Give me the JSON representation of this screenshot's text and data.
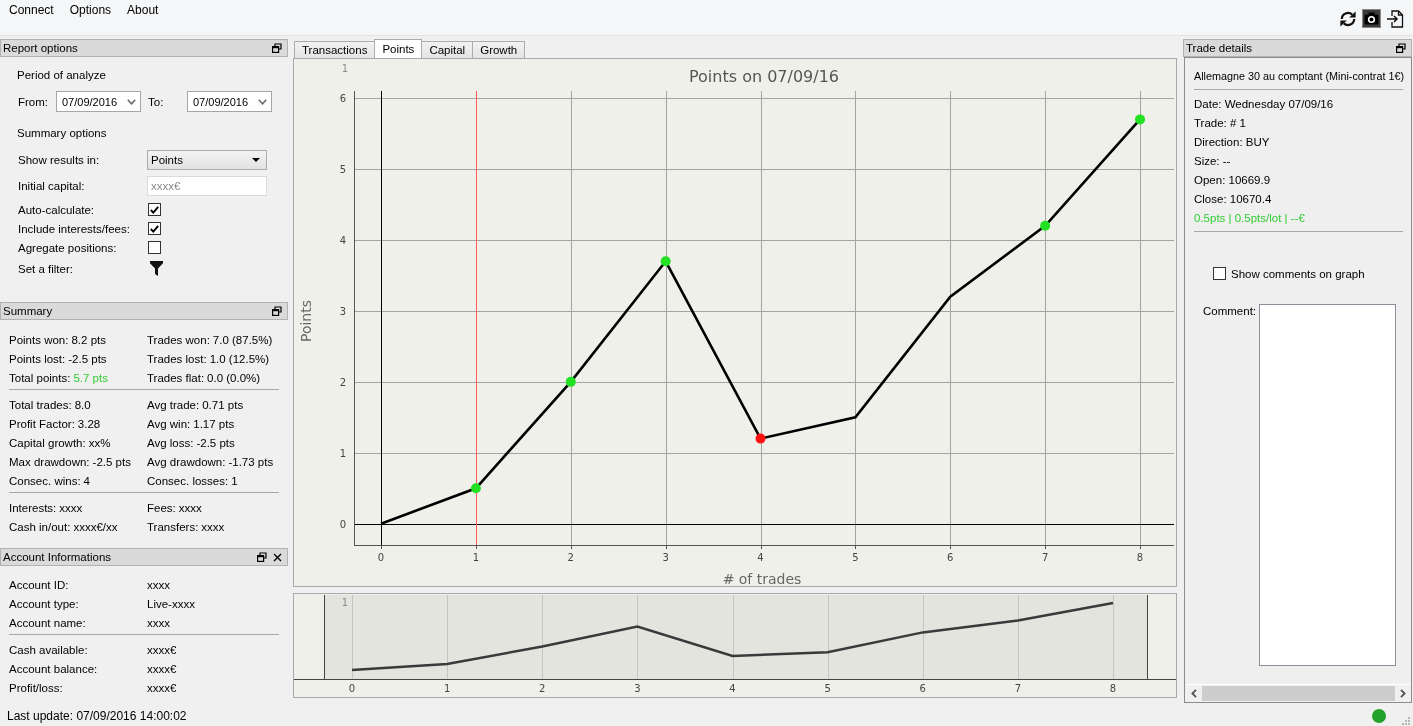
{
  "menu": [
    "Connect",
    "Options",
    "About"
  ],
  "report_options": {
    "title": "Report options",
    "closable": false,
    "period_heading": "Period of analyze",
    "from": {
      "label": "From:",
      "value": "07/09/2016"
    },
    "to": {
      "label": "To:",
      "value": "07/09/2016"
    },
    "summary_heading": "Summary options",
    "fields": [
      {
        "kind": "select",
        "label": "Show results in:",
        "value": "Points"
      },
      {
        "kind": "input",
        "label": "Initial capital:",
        "placeholder": "xxxx€"
      },
      {
        "kind": "checkbox",
        "label": "Auto-calculate:",
        "checked": true
      },
      {
        "kind": "checkbox",
        "label": "Include interests/fees:",
        "checked": true
      },
      {
        "kind": "checkbox",
        "label": "Agregate positions:",
        "checked": false
      },
      {
        "kind": "filter",
        "label": "Set a filter:"
      }
    ]
  },
  "summary": {
    "title": "Summary",
    "closable": false,
    "groups": [
      {
        "items": [
          {
            "label": "Points won:",
            "value": "8.2 pts",
            "highlighted": false
          },
          {
            "label": "Trades won:",
            "value": "7.0 (87.5%)",
            "highlighted": false
          },
          {
            "label": "Points lost:",
            "value": "-2.5 pts",
            "highlighted": false
          },
          {
            "label": "Trades lost:",
            "value": "1.0 (12.5%)",
            "highlighted": false
          },
          {
            "label": "Total points:",
            "value": "5.7 pts",
            "highlighted": true
          },
          {
            "label": "Trades flat:",
            "value": "0.0 (0.0%)",
            "highlighted": false
          }
        ]
      },
      {
        "items": [
          {
            "label": "Total trades:",
            "value": "8.0",
            "highlighted": false
          },
          {
            "label": "Avg trade:",
            "value": "0.71 pts",
            "highlighted": false
          },
          {
            "label": "Profit Factor:",
            "value": "3.28",
            "highlighted": false
          },
          {
            "label": "Avg win:",
            "value": "1.17 pts",
            "highlighted": false
          },
          {
            "label": "Capital growth:",
            "value": "xx%",
            "highlighted": false
          },
          {
            "label": "Avg loss:",
            "value": "-2.5 pts",
            "highlighted": false
          },
          {
            "label": "Max drawdown:",
            "value": "-2.5 pts",
            "highlighted": false
          },
          {
            "label": "Avg drawdown:",
            "value": "-1.73 pts",
            "highlighted": false
          },
          {
            "label": "Consec. wins:",
            "value": "4",
            "highlighted": false
          },
          {
            "label": "Consec. losses:",
            "value": "1",
            "highlighted": false
          }
        ]
      },
      {
        "items": [
          {
            "label": "Interests:",
            "value": "xxxx",
            "highlighted": false
          },
          {
            "label": "Fees:",
            "value": "xxxx",
            "highlighted": false
          },
          {
            "label": "Cash in/out:",
            "value": "xxxx€/xx",
            "highlighted": false
          },
          {
            "label": "Transfers:",
            "value": "xxxx",
            "highlighted": false
          }
        ]
      }
    ]
  },
  "account": {
    "title": "Account Informations",
    "closable": true,
    "groups": [
      {
        "items": [
          {
            "label": "Account ID:",
            "value": "xxxx"
          },
          {
            "label": "Account type:",
            "value": "Live-xxxx"
          },
          {
            "label": "Account name:",
            "value": "xxxx"
          }
        ]
      },
      {
        "items": [
          {
            "label": "Cash available:",
            "value": "xxxx€"
          },
          {
            "label": "Account balance:",
            "value": "xxxx€"
          },
          {
            "label": "Profit/loss:",
            "value": "xxxx€"
          }
        ]
      }
    ]
  },
  "tabs": [
    {
      "label": "Transactions",
      "selected": false
    },
    {
      "label": "Points",
      "selected": true
    },
    {
      "label": "Capital",
      "selected": false
    },
    {
      "label": "Growth",
      "selected": false
    }
  ],
  "main_chart": {
    "corner_label": "1",
    "chart_data": {
      "type": "line",
      "title": "Points on 07/09/16",
      "xlabel": "# of trades",
      "ylabel": "Points",
      "x": [
        0,
        1,
        2,
        3,
        4,
        5,
        6,
        7,
        8
      ],
      "series": [
        {
          "color": "#000000",
          "values": [
            0,
            0.5,
            2.0,
            3.7,
            1.2,
            1.5,
            3.2,
            4.2,
            5.7
          ]
        },
        {
          "type": "scatter",
          "color": "#22e022",
          "values": [
            null,
            0.5,
            2.0,
            3.7,
            null,
            null,
            null,
            4.2,
            5.7
          ]
        },
        {
          "type": "scatter",
          "color": "#ff1010",
          "values": [
            null,
            null,
            null,
            null,
            1.2,
            null,
            null,
            null,
            null
          ]
        }
      ],
      "xlim": [
        -0.285,
        8.358
      ],
      "ylim": [
        -0.3,
        6.1
      ],
      "xticks": [
        0,
        1,
        2,
        3,
        4,
        5,
        6,
        7,
        8
      ],
      "yticks": [
        0,
        1,
        2,
        3,
        4,
        5,
        6
      ],
      "grid": true,
      "ref_lines": [
        {
          "axis": "x",
          "value": 1,
          "color": "#ff5a5a"
        }
      ]
    }
  },
  "overview_chart": {
    "corner_label": "1",
    "x_labels": [
      "0",
      "1",
      "2",
      "3",
      "4",
      "5",
      "6",
      "7",
      "8"
    ]
  },
  "trade_details": {
    "title": "Trade details",
    "closable": false,
    "instrument": "Allemagne 30 au comptant (Mini-contrat 1€)",
    "lines": [
      "Date: Wednesday 07/09/16",
      "Trade: # 1",
      "Direction: BUY",
      "Size: --",
      "Open: 10669.9",
      "Close: 10670.4"
    ],
    "result": "0.5pts | 0.5pts/lot | --€",
    "show_comments": {
      "label": "Show comments on graph",
      "checked": false
    },
    "comment_label": "Comment:"
  },
  "status_bar": {
    "last_update": "Last update: 07/09/2016 14:00:02",
    "connected": true
  }
}
